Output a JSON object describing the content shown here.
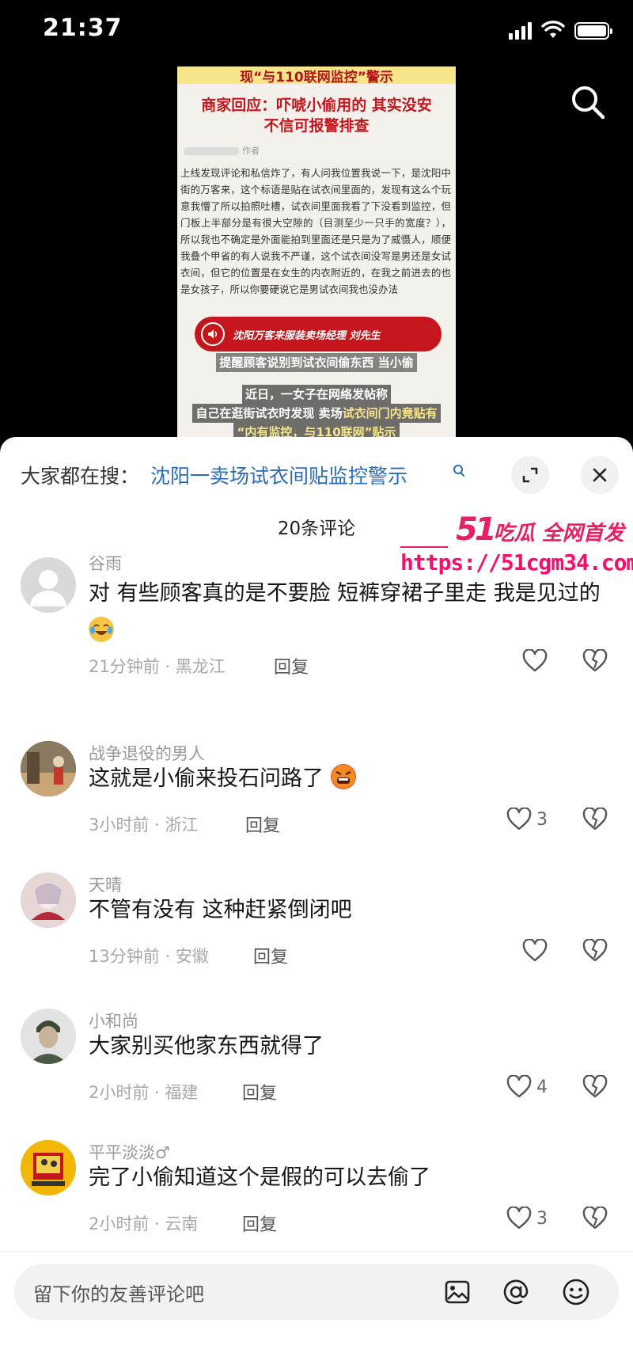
{
  "status": {
    "time": "21:37",
    "icons": [
      "signal-icon",
      "wifi-icon",
      "battery-icon"
    ]
  },
  "video": {
    "top_banner": "现“与110联网监控”警示",
    "headline_line1": "商家回应：吓唬小偷用的 其实没安",
    "headline_line2": "不信可报警排查",
    "author_label": "作者",
    "body_text": "上线发现评论和私信炸了，有人问我位置我说一下，是沈阳中街的万客来，这个标语是贴在试衣间里面的，发现有这么个玩意我懵了所以拍照吐槽，试衣间里面我看了下没看到监控，但门板上半部分是有很大空隙的（目测至少一只手的宽度？），所以我也不确定是外面能拍到里面还是只是为了威慑人，顺便我叠个甲省的有人说我不严谨，这个试衣间没写是男还是女试衣间，但它的位置是在女生的内衣附近的，在我之前进去的也是女孩子，所以你要硬说它是男试衣间我也没办法",
    "speaker_banner": "沈阳万客来服装卖场经理 刘先生",
    "subtitle": "提醒顾客说别到试衣间偷东西 当小偷",
    "caption_line1": "近日，一女子在网络发帖称",
    "caption_line2_a": "自己在逛街试衣时发现 卖场",
    "caption_line2_b": "试衣间门内竟贴有",
    "caption_line3": "“内有监控，与110联网”贴示"
  },
  "sheet": {
    "search_prefix": "大家都在搜：",
    "search_query": "沈阳一卖场试衣间贴监控警示",
    "comment_count": "20条评论",
    "icons": [
      "expand-icon",
      "close-icon"
    ]
  },
  "watermark": {
    "line1_num": "51",
    "line1_text": "吃瓜 全网首发",
    "url": "https://51cgm34.com"
  },
  "comments": [
    {
      "user": "谷雨",
      "text": "对 有些顾客真的是不要脸 短裤穿裙子里走 我是见过的",
      "emoji": "crying-laughing-emoji",
      "meta": "21分钟前 · 黑龙江",
      "reply": "回复",
      "likes": ""
    },
    {
      "user": "战争退役的男人",
      "text": "这就是小偷来投石问路了",
      "emoji": "angry-cursing-emoji",
      "meta": "3小时前 · 浙江",
      "reply": "回复",
      "likes": "3"
    },
    {
      "user": "天晴",
      "text": "不管有没有 这种赶紧倒闭吧",
      "meta": "13分钟前 · 安徽",
      "reply": "回复",
      "likes": ""
    },
    {
      "user": "小和尚",
      "text": "大家别买他家东西就得了",
      "meta": "2小时前 · 福建",
      "reply": "回复",
      "likes": "4"
    },
    {
      "user": "平平淡淡♂",
      "text": "完了小偷知道这个是假的可以去偷了",
      "meta": "2小时前 · 云南",
      "reply": "回复",
      "likes": "3"
    }
  ],
  "input": {
    "placeholder": "留下你的友善评论吧",
    "icons": [
      "image-icon",
      "at-icon",
      "emoji-icon"
    ]
  },
  "colors": {
    "link": "#2b6cb8",
    "watermark": "#ff0a6c",
    "headline_red": "#c4161c"
  }
}
